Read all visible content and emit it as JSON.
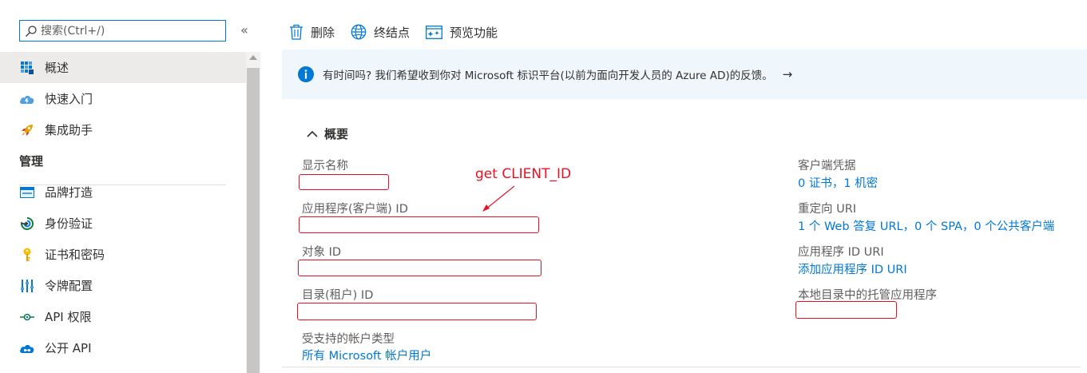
{
  "sidebar": {
    "search_placeholder": "搜索(Ctrl+/)",
    "collapse_glyph": "«",
    "items_top": [
      {
        "label": "概述",
        "icon": "overview-grid-icon",
        "selected": true
      },
      {
        "label": "快速入门",
        "icon": "quickstart-cloud-icon"
      },
      {
        "label": "集成助手",
        "icon": "rocket-icon"
      }
    ],
    "section_manage": "管理",
    "items_manage": [
      {
        "label": "品牌打造",
        "icon": "branding-icon"
      },
      {
        "label": "身份验证",
        "icon": "authentication-icon"
      },
      {
        "label": "证书和密码",
        "icon": "key-icon"
      },
      {
        "label": "令牌配置",
        "icon": "token-config-icon"
      },
      {
        "label": "API 权限",
        "icon": "api-permissions-icon"
      },
      {
        "label": "公开 API",
        "icon": "expose-api-cloud-icon"
      }
    ]
  },
  "toolbar": {
    "delete_label": "删除",
    "endpoints_label": "终结点",
    "preview_label": "预览功能"
  },
  "banner": {
    "text": "有时间吗? 我们希望收到你对 Microsoft 标识平台(以前为面向开发人员的 Azure AD)的反馈。",
    "arrow": "→"
  },
  "essentials": {
    "title": "概要",
    "left": {
      "display_name_label": "显示名称",
      "client_id_label": "应用程序(客户端) ID",
      "object_id_label": "对象 ID",
      "tenant_id_label": "目录(租户) ID",
      "account_types_label": "受支持的帐户类型",
      "account_types_value": "所有 Microsoft 帐户用户"
    },
    "right": {
      "client_credentials_label": "客户端凭据",
      "client_credentials_value": "0 证书，1 机密",
      "redirect_uris_label": "重定向 URI",
      "redirect_uris_value": "1 个 Web 答复 URL，0 个 SPA，0 个公共客户端",
      "app_id_uri_label": "应用程序 ID URI",
      "app_id_uri_value": "添加应用程序 ID URI",
      "managed_app_label": "本地目录中的托管应用程序"
    }
  },
  "annotation": {
    "text": "get CLIENT_ID",
    "color": "#e81123"
  },
  "colors": {
    "accent": "#0078d4",
    "banner_bg": "#eff6fc",
    "selected_bg": "#edebe9",
    "redact_border": "#e81123"
  }
}
